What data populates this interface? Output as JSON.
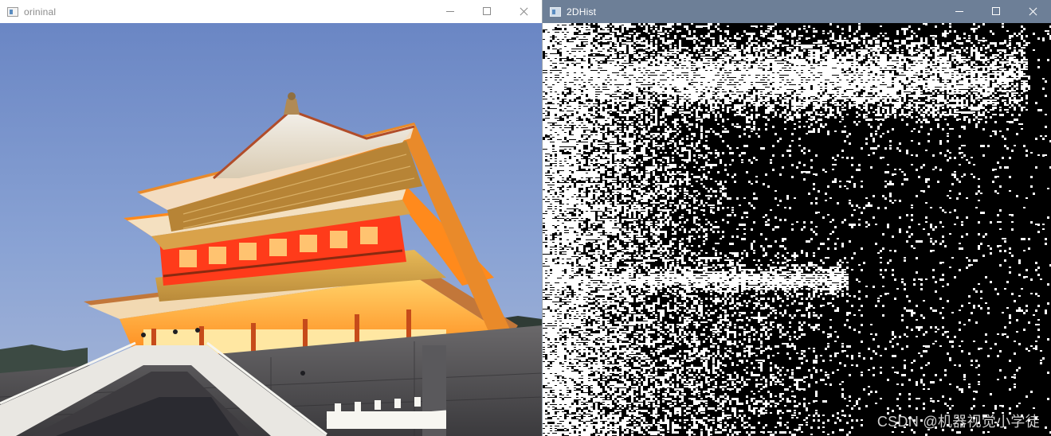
{
  "windows": {
    "left": {
      "title": "orininal",
      "image_subject": "photo"
    },
    "right": {
      "title": "2DHist",
      "image_subject": "2d-histogram",
      "watermark": "CSDN @机器视觉小学徒"
    }
  },
  "colors": {
    "left_titlebar_bg": "#ffffff",
    "right_titlebar_bg": "#6d7f97",
    "sky_top": "#6f8cc8",
    "sky_bottom": "#9fb1d6",
    "roof_gold": "#e8b24a",
    "eave_orange": "#ff8a1c",
    "lantern_red": "#ff3b1a",
    "wall_gray": "#4e4d50",
    "hist_bg": "#000000",
    "hist_fg": "#ffffff"
  }
}
